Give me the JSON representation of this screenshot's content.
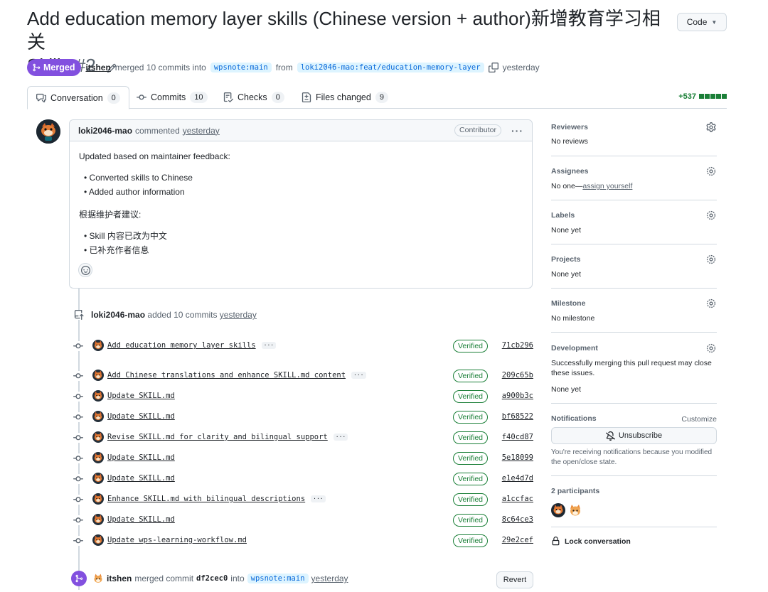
{
  "header": {
    "title": "Add education memory layer skills (Chinese version + author)新增教育学习相关",
    "title_line2": "Skills",
    "number": "#2",
    "code_button": "Code"
  },
  "status": {
    "badge": "Merged",
    "author": "itshen",
    "merged_text": "merged 10 commits into",
    "base_branch": "wpsnote:main",
    "from_text": "from",
    "head_branch": "loki2046-mao:feat/education-memory-layer",
    "time": "yesterday"
  },
  "tabs": [
    {
      "label": "Conversation",
      "count": "0"
    },
    {
      "label": "Commits",
      "count": "10"
    },
    {
      "label": "Checks",
      "count": "0"
    },
    {
      "label": "Files changed",
      "count": "9"
    }
  ],
  "diffstat": "+537",
  "comment": {
    "author": "loki2046-mao",
    "action": "commented",
    "time": "yesterday",
    "role_badge": "Contributor",
    "kebab": "···",
    "intro_en": "Updated based on maintainer feedback:",
    "bullets_en": [
      "Converted skills to Chinese",
      "Added author information"
    ],
    "intro_zh": "根据维护者建议:",
    "bullets_zh": [
      "Skill 内容已改为中文",
      "已补充作者信息"
    ]
  },
  "push_event": {
    "author": "loki2046-mao",
    "action": "added 10 commits",
    "time": "yesterday"
  },
  "commits": [
    {
      "message": "Add education memory layer skills",
      "has_more": true,
      "badge": "Verified",
      "sha": "71cb296"
    },
    {
      "message": "Add Chinese translations and enhance SKILL.md content",
      "has_more": true,
      "badge": "Verified",
      "sha": "209c65b"
    },
    {
      "message": "Update SKILL.md",
      "has_more": false,
      "badge": "Verified",
      "sha": "a900b3c"
    },
    {
      "message": "Update SKILL.md",
      "has_more": false,
      "badge": "Verified",
      "sha": "bf68522"
    },
    {
      "message": "Revise SKILL.md for clarity and bilingual support",
      "has_more": true,
      "badge": "Verified",
      "sha": "f40cd87"
    },
    {
      "message": "Update SKILL.md",
      "has_more": false,
      "badge": "Verified",
      "sha": "5e18099"
    },
    {
      "message": "Update SKILL.md",
      "has_more": false,
      "badge": "Verified",
      "sha": "e1e4d7d"
    },
    {
      "message": "Enhance SKILL.md with bilingual descriptions",
      "has_more": true,
      "badge": "Verified",
      "sha": "a1ccfac"
    },
    {
      "message": "Update SKILL.md",
      "has_more": false,
      "badge": "Verified",
      "sha": "8c64ce3"
    },
    {
      "message": "Update wps-learning-workflow.md",
      "has_more": false,
      "badge": "Verified",
      "sha": "29e2cef"
    }
  ],
  "merge_event": {
    "author": "itshen",
    "action": "merged commit",
    "sha": "df2cec0",
    "into": "into",
    "branch": "wpsnote:main",
    "time": "yesterday",
    "revert_button": "Revert"
  },
  "sidebar": {
    "reviewers": {
      "title": "Reviewers",
      "value": "No reviews"
    },
    "assignees": {
      "title": "Assignees",
      "value": "No one—",
      "link": "assign yourself"
    },
    "labels": {
      "title": "Labels",
      "value": "None yet"
    },
    "projects": {
      "title": "Projects",
      "value": "None yet"
    },
    "milestone": {
      "title": "Milestone",
      "value": "No milestone"
    },
    "development": {
      "title": "Development",
      "desc": "Successfully merging this pull request may close these issues.",
      "value": "None yet"
    },
    "notifications": {
      "title": "Notifications",
      "customize": "Customize",
      "button": "Unsubscribe",
      "desc": "You're receiving notifications because you modified the open/close state."
    },
    "participants": {
      "title": "2 participants"
    },
    "lock": "Lock conversation"
  },
  "colors": {
    "merged": "#8250df",
    "verified": "#1a7f37",
    "branch_bg": "#ddf4ff",
    "branch_text": "#0969da"
  }
}
